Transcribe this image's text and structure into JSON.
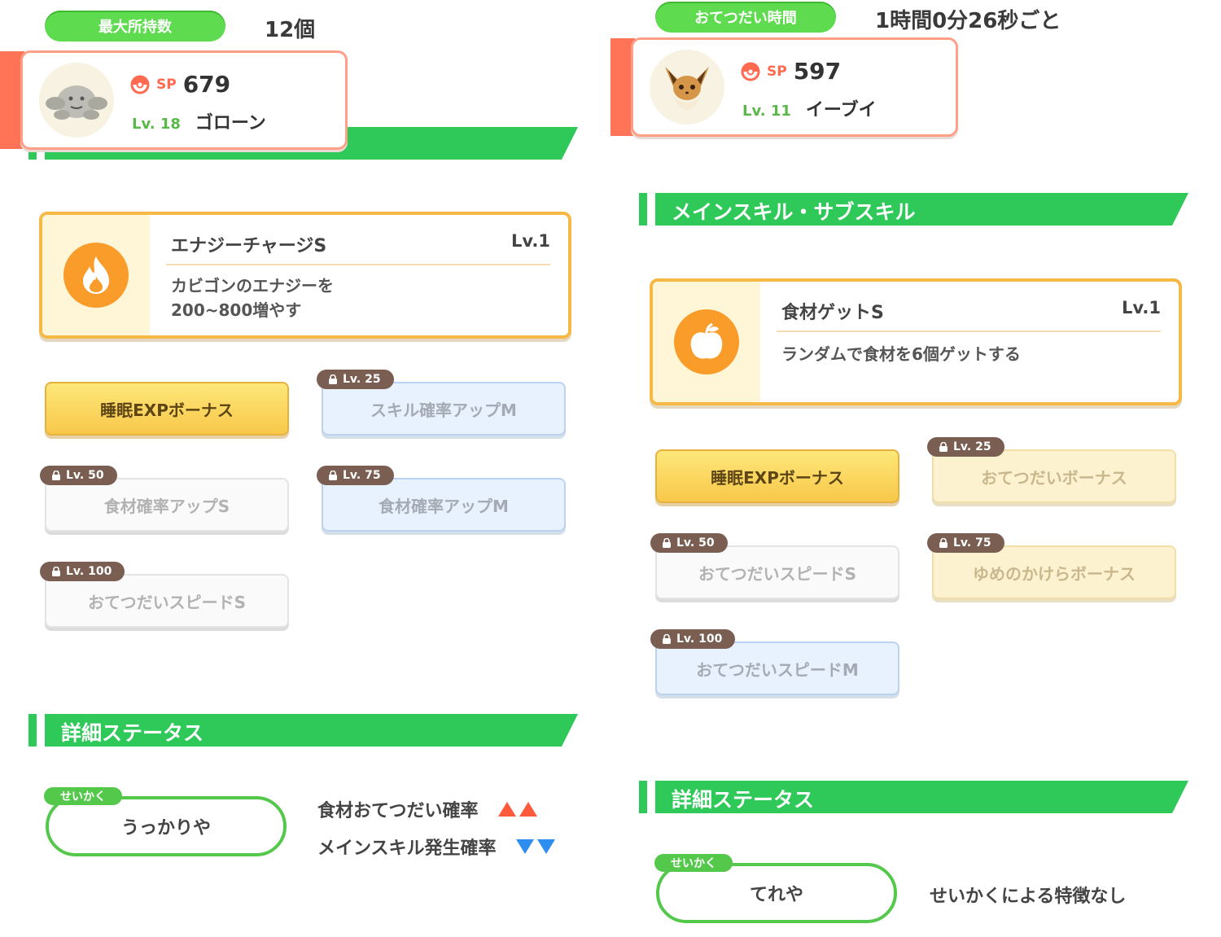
{
  "left": {
    "info_pill": "最大所持数",
    "info_value": "12個",
    "pokemon": {
      "sp_label": "SP",
      "sp_value": "679",
      "level": "Lv. 18",
      "name": "ゴローン"
    },
    "main_skill": {
      "name": "エナジーチャージS",
      "level": "Lv.1",
      "desc_line1": "カビゴンのエナジーを",
      "desc_line2": "200~800増やす"
    },
    "sub_skills": [
      {
        "label": "睡眠EXPボーナス",
        "lock": ""
      },
      {
        "label": "スキル確率アップM",
        "lock": "Lv. 25"
      },
      {
        "label": "食材確率アップS",
        "lock": "Lv. 50"
      },
      {
        "label": "食材確率アップM",
        "lock": "Lv. 75"
      },
      {
        "label": "おてつだいスピードS",
        "lock": "Lv. 100"
      }
    ],
    "status_header": "詳細ステータス",
    "nature": {
      "tag": "せいかく",
      "name": "うっかりや",
      "effect_up": "食材おてつだい確率",
      "effect_down": "メインスキル発生確率"
    }
  },
  "right": {
    "info_pill": "おてつだい時間",
    "info_value": "1時間0分26秒ごと",
    "pokemon": {
      "sp_label": "SP",
      "sp_value": "597",
      "level": "Lv. 11",
      "name": "イーブイ"
    },
    "skill_header": "メインスキル・サブスキル",
    "main_skill": {
      "name": "食材ゲットS",
      "level": "Lv.1",
      "desc_line1": "ランダムで食材を6個ゲットする"
    },
    "sub_skills": [
      {
        "label": "睡眠EXPボーナス",
        "lock": ""
      },
      {
        "label": "おてつだいボーナス",
        "lock": "Lv. 25"
      },
      {
        "label": "おてつだいスピードS",
        "lock": "Lv. 50"
      },
      {
        "label": "ゆめのかけらボーナス",
        "lock": "Lv. 75"
      },
      {
        "label": "おてつだいスピードM",
        "lock": "Lv. 100"
      }
    ],
    "status_header": "詳細ステータス",
    "nature": {
      "tag": "せいかく",
      "name": "てれや",
      "effect_text": "せいかくによる特徴なし"
    }
  },
  "colors": {
    "green": "#2ec958",
    "pill_green": "#5fdb4f",
    "accent": "#ff7456",
    "gold_border": "#f6b945",
    "up_arrow": "#ff5a3c",
    "down_arrow": "#2d8ef0"
  },
  "icons": {
    "sp": "pokeball-icon",
    "skill_left": "flame-icon",
    "skill_right": "apple-icon",
    "lock": "lock-icon"
  }
}
